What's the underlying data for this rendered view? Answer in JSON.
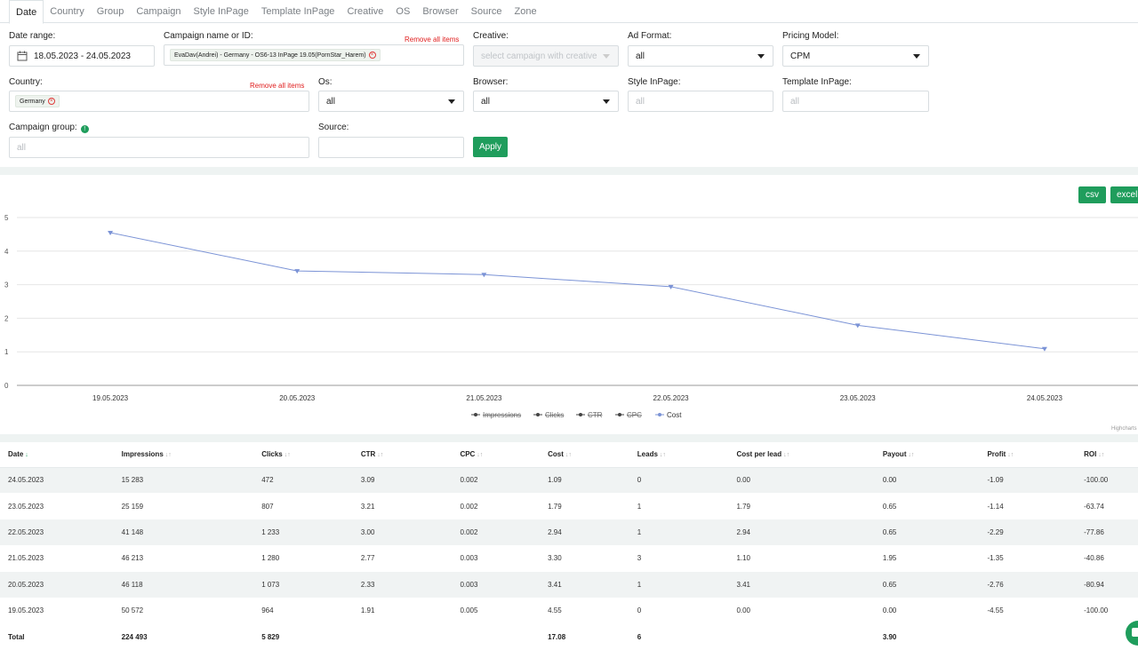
{
  "tabs": [
    "Date",
    "Country",
    "Group",
    "Campaign",
    "Style InPage",
    "Template InPage",
    "Creative",
    "OS",
    "Browser",
    "Source",
    "Zone"
  ],
  "filters": {
    "date_range": {
      "label": "Date range:",
      "value": "18.05.2023 - 24.05.2023"
    },
    "campaign": {
      "label": "Campaign name or ID:",
      "remove": "Remove all items",
      "tag": "EvaDav(Andrei) - Germany - OS6-13 InPage 19.05(PornStar_Harem)"
    },
    "creative": {
      "label": "Creative:",
      "placeholder": "select campaign with creative"
    },
    "ad_format": {
      "label": "Ad Format:",
      "value": "all"
    },
    "pricing_model": {
      "label": "Pricing Model:",
      "value": "CPM"
    },
    "country": {
      "label": "Country:",
      "remove": "Remove all items",
      "tag": "Germany"
    },
    "os": {
      "label": "Os:",
      "value": "all"
    },
    "browser": {
      "label": "Browser:",
      "value": "all"
    },
    "style_inpage": {
      "label": "Style InPage:",
      "placeholder": "all"
    },
    "template_inpage": {
      "label": "Template InPage:",
      "placeholder": "all"
    },
    "campaign_group": {
      "label": "Campaign group:",
      "placeholder": "all",
      "info": "!"
    },
    "source": {
      "label": "Source:",
      "placeholder": ""
    },
    "apply": "Apply"
  },
  "export": {
    "csv": "csv",
    "excel": "excel"
  },
  "chart_data": {
    "type": "line",
    "x": [
      "19.05.2023",
      "20.05.2023",
      "21.05.2023",
      "22.05.2023",
      "23.05.2023",
      "24.05.2023"
    ],
    "series": [
      {
        "name": "Impressions",
        "visible": false
      },
      {
        "name": "Clicks",
        "visible": false
      },
      {
        "name": "CTR",
        "visible": false
      },
      {
        "name": "CPC",
        "visible": false
      },
      {
        "name": "Cost",
        "visible": true,
        "values": [
          4.55,
          3.41,
          3.3,
          2.94,
          1.79,
          1.09
        ],
        "color": "#7b93d6"
      }
    ],
    "yticks": [
      0,
      1,
      2,
      3,
      4,
      5
    ],
    "ylim": [
      0,
      5
    ],
    "legend": "bottom",
    "credit": "Highcharts"
  },
  "table": {
    "headers": [
      "Date",
      "Impressions",
      "Clicks",
      "CTR",
      "CPC",
      "Cost",
      "Leads",
      "Cost per lead",
      "Payout",
      "Profit",
      "ROI"
    ],
    "rows": [
      [
        "24.05.2023",
        "15 283",
        "472",
        "3.09",
        "0.002",
        "1.09",
        "0",
        "0.00",
        "0.00",
        "-1.09",
        "-100.00"
      ],
      [
        "23.05.2023",
        "25 159",
        "807",
        "3.21",
        "0.002",
        "1.79",
        "1",
        "1.79",
        "0.65",
        "-1.14",
        "-63.74"
      ],
      [
        "22.05.2023",
        "41 148",
        "1 233",
        "3.00",
        "0.002",
        "2.94",
        "1",
        "2.94",
        "0.65",
        "-2.29",
        "-77.86"
      ],
      [
        "21.05.2023",
        "46 213",
        "1 280",
        "2.77",
        "0.003",
        "3.30",
        "3",
        "1.10",
        "1.95",
        "-1.35",
        "-40.86"
      ],
      [
        "20.05.2023",
        "46 118",
        "1 073",
        "2.33",
        "0.003",
        "3.41",
        "1",
        "3.41",
        "0.65",
        "-2.76",
        "-80.94"
      ],
      [
        "19.05.2023",
        "50 572",
        "964",
        "1.91",
        "0.005",
        "4.55",
        "0",
        "0.00",
        "0.00",
        "-4.55",
        "-100.00"
      ]
    ],
    "total": [
      "Total",
      "224 493",
      "5 829",
      "",
      "",
      "17.08",
      "6",
      "",
      "3.90",
      "",
      ""
    ]
  },
  "colors": {
    "accent": "#1f9d5c",
    "remove": "#e02020",
    "line": "#7b93d6"
  }
}
